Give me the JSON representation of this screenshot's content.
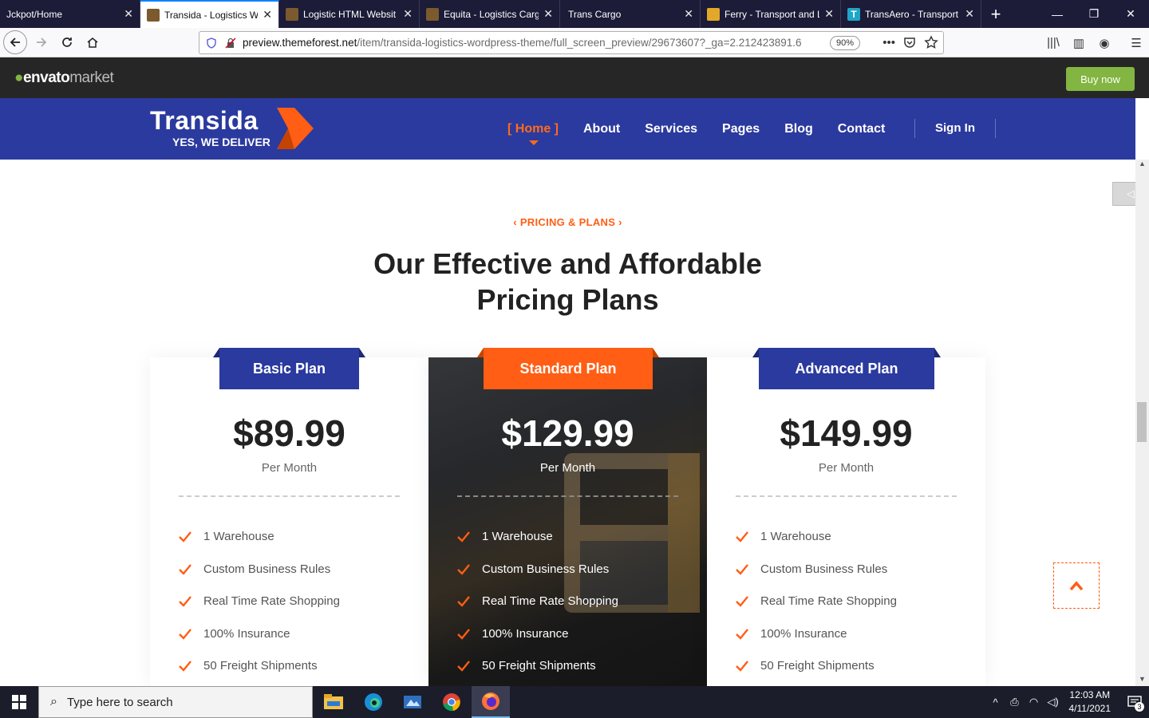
{
  "browser": {
    "tabs": [
      {
        "title": "Jckpot/Home",
        "active": false,
        "icon_color": ""
      },
      {
        "title": "Transida - Logistics W",
        "active": true,
        "icon_color": "#7b5a2e"
      },
      {
        "title": "Logistic HTML Websit",
        "active": false,
        "icon_color": "#7b5a2e"
      },
      {
        "title": "Equita - Logistics Carg",
        "active": false,
        "icon_color": "#7b5a2e"
      },
      {
        "title": "Trans Cargo",
        "active": false,
        "icon_color": ""
      },
      {
        "title": "Ferry - Transport and L",
        "active": false,
        "icon_color": "#e2a829"
      },
      {
        "title": "TransAero - Transport",
        "active": false,
        "icon_color": "#1fa6c7"
      }
    ],
    "url_host": "preview.themeforest.net",
    "url_path": "/item/transida-logistics-wordpress-theme/full_screen_preview/29673607?_ga=2.212423891.6",
    "zoom": "90%"
  },
  "envato": {
    "logo_main": "envato",
    "logo_sub": "market",
    "buy_label": "Buy now",
    "green": "#82b541"
  },
  "site": {
    "brand_name": "Transida",
    "tagline": "YES, WE DELIVER",
    "menu": [
      "[ Home ]",
      "About",
      "Services",
      "Pages",
      "Blog",
      "Contact"
    ],
    "signin": "Sign In",
    "header_color": "#2b3a9e",
    "accent": "#ff5e14"
  },
  "section": {
    "eyebrow": "PRICING & PLANS",
    "heading_line1": "Our Effective and Affordable",
    "heading_line2": "Pricing Plans"
  },
  "plans": [
    {
      "name": "Basic Plan",
      "price": "$89.99",
      "period": "Per Month",
      "features": [
        "1 Warehouse",
        "Custom Business Rules",
        "Real Time Rate Shopping",
        "100% Insurance",
        "50 Freight Shipments"
      ]
    },
    {
      "name": "Standard Plan",
      "price": "$129.99",
      "period": "Per Month",
      "features": [
        "1 Warehouse",
        "Custom Business Rules",
        "Real Time Rate Shopping",
        "100% Insurance",
        "50 Freight Shipments"
      ]
    },
    {
      "name": "Advanced Plan",
      "price": "$149.99",
      "period": "Per Month",
      "features": [
        "1 Warehouse",
        "Custom Business Rules",
        "Real Time Rate Shopping",
        "100% Insurance",
        "50 Freight Shipments"
      ]
    }
  ],
  "taskbar": {
    "search_placeholder": "Type here to search",
    "time": "12:03 AM",
    "date": "4/11/2021",
    "notification_count": "3"
  }
}
